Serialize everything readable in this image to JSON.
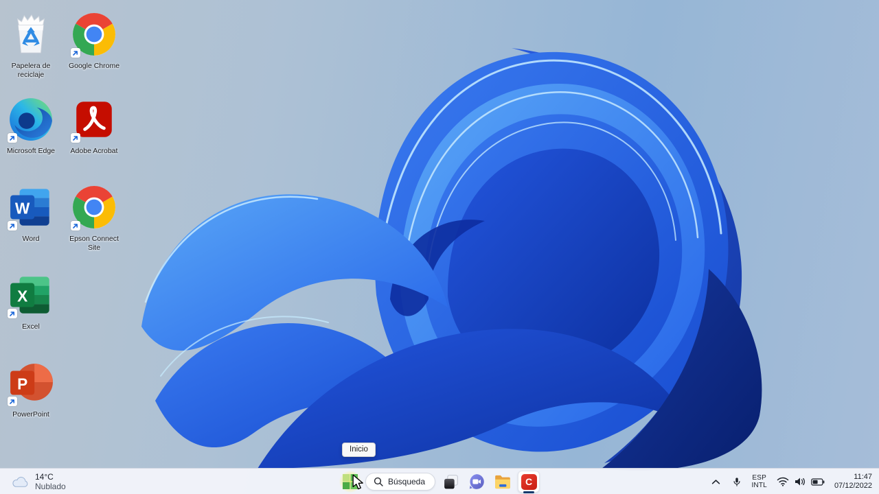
{
  "desktop": {
    "icons": [
      {
        "label": "Papelera de reciclaje",
        "kind": "recycle-bin"
      },
      {
        "label": "Google Chrome",
        "kind": "chrome"
      },
      {
        "label": "Microsoft Edge",
        "kind": "edge"
      },
      {
        "label": "Adobe Acrobat",
        "kind": "acrobat"
      },
      {
        "label": "Word",
        "kind": "word"
      },
      {
        "label": "Epson Connect Site",
        "kind": "chrome"
      },
      {
        "label": "Excel",
        "kind": "excel"
      },
      {
        "label": "PowerPoint",
        "kind": "powerpoint"
      }
    ],
    "icon_letters": {
      "word": "W",
      "excel": "X",
      "powerpoint": "P"
    }
  },
  "tooltip": {
    "label": "Inicio"
  },
  "taskbar": {
    "weather": {
      "temperature": "14°C",
      "condition": "Nublado"
    },
    "search": {
      "label": "Búsqueda"
    },
    "camtasia_letter": "C",
    "tray": {
      "language_top": "ESP",
      "language_bottom": "INTL",
      "time": "11:47",
      "date": "07/12/2022"
    }
  },
  "colors": {
    "accent_blue": "#2563e8",
    "taskbar_bg": "#f2f4fa",
    "camtasia_red": "#d62f23",
    "start_glow_yellow": "#f9f078",
    "wallpaper_sky": "#9cb9d8"
  }
}
